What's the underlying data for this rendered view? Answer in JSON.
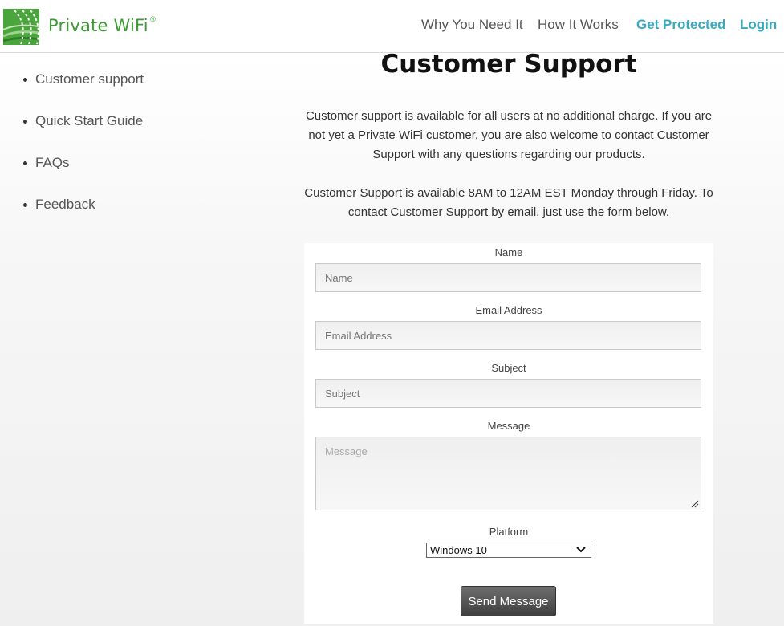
{
  "brand": {
    "name": "Private WiFi",
    "reg_mark": "®",
    "logo_color": "#3b9b32"
  },
  "nav": {
    "why": "Why You Need It",
    "how": "How It Works",
    "protect": "Get Protected",
    "login": "Login",
    "accent_color": "#3aa8c3"
  },
  "sidebar": {
    "items": [
      {
        "label": "Customer support"
      },
      {
        "label": "Quick Start Guide"
      },
      {
        "label": "FAQs"
      },
      {
        "label": "Feedback"
      }
    ]
  },
  "main": {
    "title": "Customer Support",
    "para1": "Customer support is available for all users at no additional charge. If you are not yet a Private WiFi customer, you are also welcome to contact Customer Support with any questions regarding our products.",
    "para2": "Customer Support is available 8AM to 12AM EST Monday through Friday. To contact Customer Support by email, just use the form below."
  },
  "form": {
    "name_label": "Name",
    "name_placeholder": "Name",
    "name_value": "",
    "email_label": "Email Address",
    "email_placeholder": "Email Address",
    "email_value": "",
    "subject_label": "Subject",
    "subject_placeholder": "Subject",
    "subject_value": "",
    "message_label": "Message",
    "message_placeholder": "Message",
    "message_value": "",
    "platform_label": "Platform",
    "platform_value": "Windows 10",
    "send_label": "Send Message"
  }
}
